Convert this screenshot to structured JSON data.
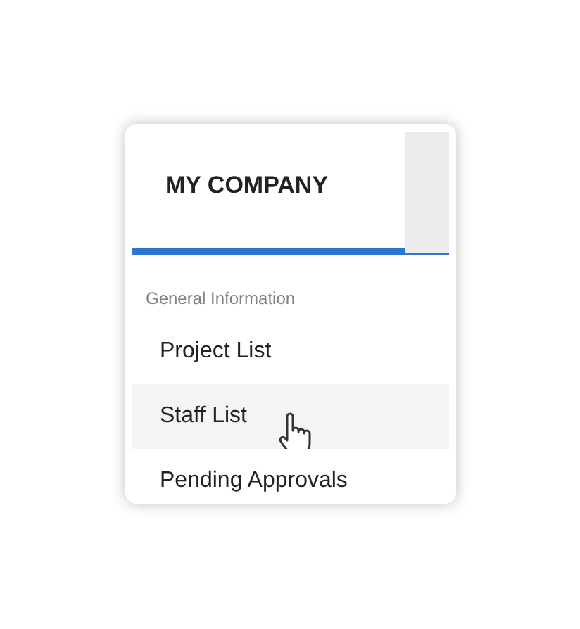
{
  "tabs": [
    {
      "label": "MY COMPANY",
      "selected": true
    },
    {
      "selected": false
    }
  ],
  "menu": {
    "section": "General Information",
    "items": [
      {
        "label": "Project List",
        "highlighted": false
      },
      {
        "label": "Staff List",
        "highlighted": true
      },
      {
        "label": "Pending Approvals",
        "highlighted": false
      }
    ]
  }
}
